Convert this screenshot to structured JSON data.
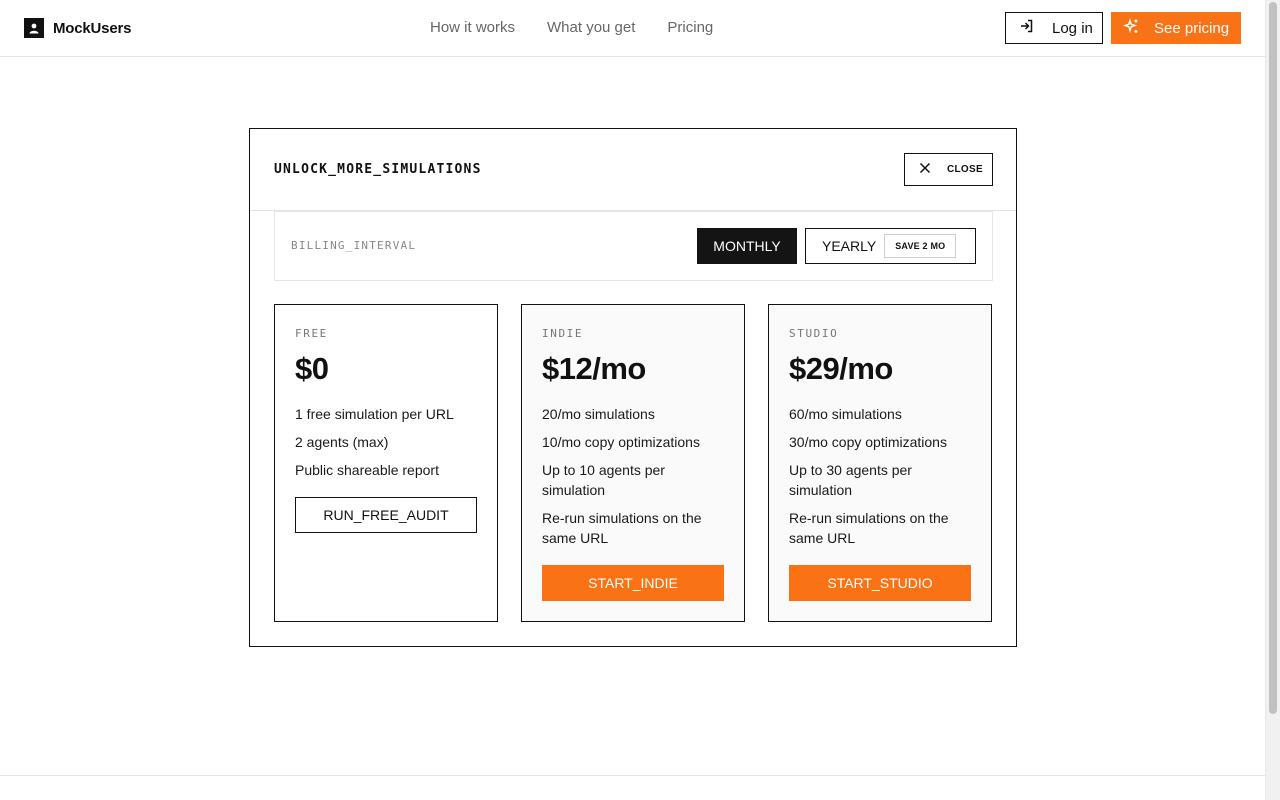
{
  "header": {
    "brand": "MockUsers",
    "nav": [
      "How it works",
      "What you get",
      "Pricing"
    ],
    "login_label": "Log in",
    "pricing_label": "See pricing"
  },
  "modal": {
    "title": "UNLOCK_MORE_SIMULATIONS",
    "close_label": "CLOSE",
    "billing": {
      "label": "BILLING_INTERVAL",
      "monthly": "MONTHLY",
      "yearly": "YEARLY",
      "save_badge": "SAVE 2 MO",
      "selected": "monthly"
    },
    "plans": [
      {
        "tier": "FREE",
        "price": "$0",
        "features": [
          "1 free simulation per URL",
          "2 agents (max)",
          "Public shareable report"
        ],
        "cta": "RUN_FREE_AUDIT"
      },
      {
        "tier": "INDIE",
        "price": "$12/mo",
        "features": [
          "20/mo simulations",
          "10/mo copy optimizations",
          "Up to 10 agents per simulation",
          "Re-run simulations on the same URL"
        ],
        "cta": "START_INDIE"
      },
      {
        "tier": "STUDIO",
        "price": "$29/mo",
        "features": [
          "60/mo simulations",
          "30/mo copy optimizations",
          "Up to 30 agents per simulation",
          "Re-run simulations on the same URL"
        ],
        "cta": "START_STUDIO"
      }
    ]
  },
  "colors": {
    "accent": "#f97316",
    "dark": "#141414"
  }
}
